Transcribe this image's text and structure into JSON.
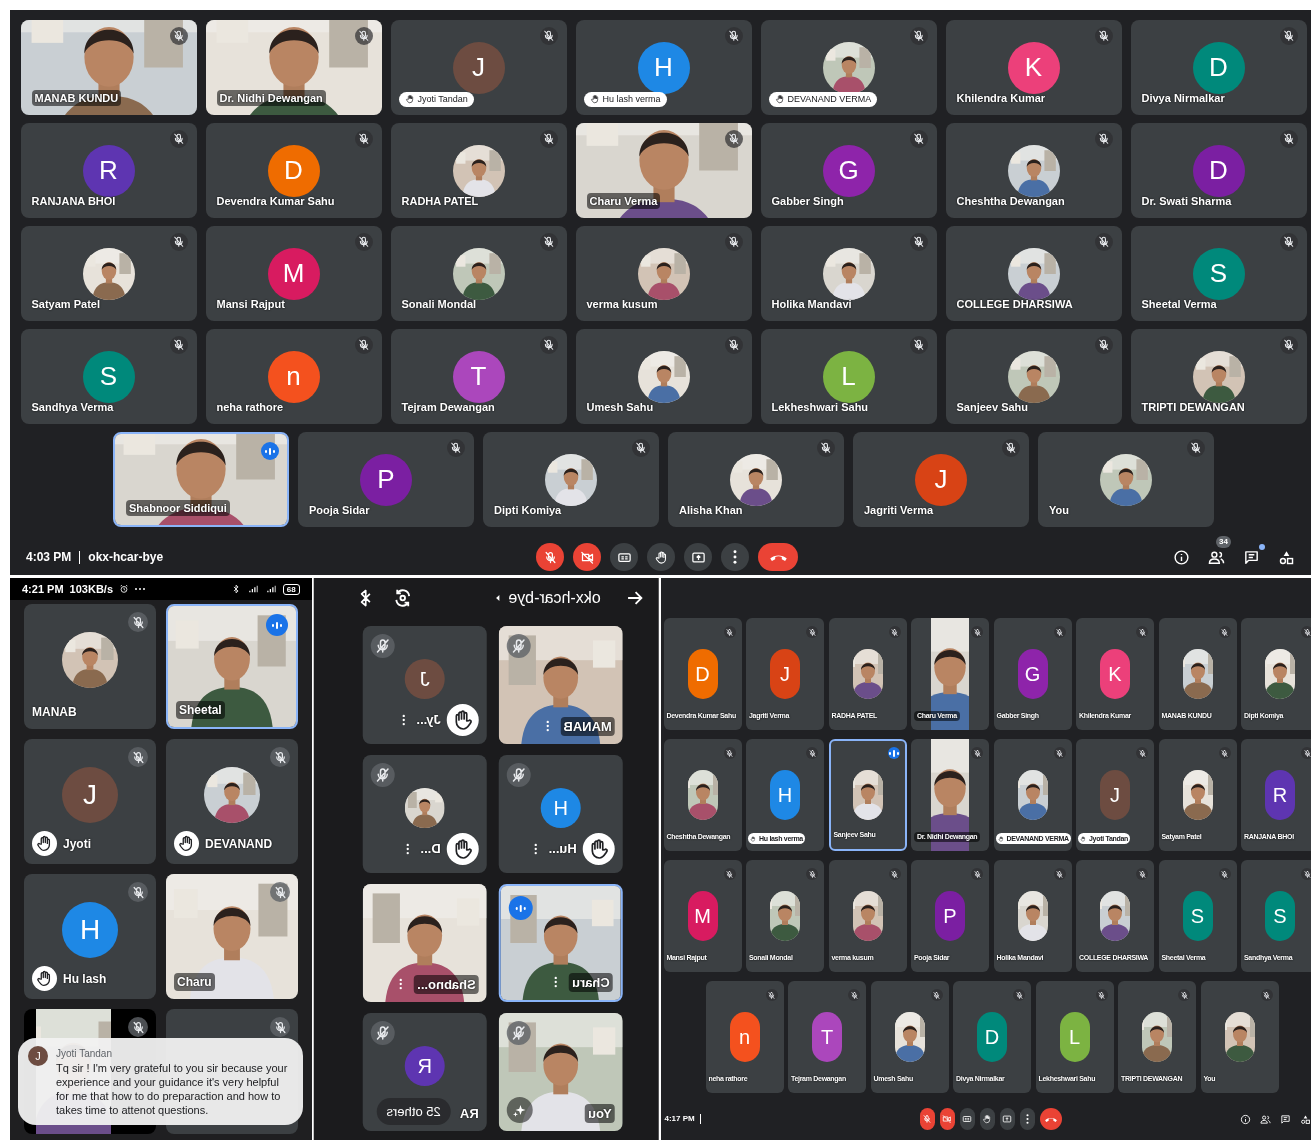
{
  "desktop_meeting": {
    "rows": [
      [
        {
          "name": "MANAB KUNDU",
          "kind": "video",
          "hand": false,
          "speaking": false,
          "muted": true
        },
        {
          "name": "Dr. Nidhi Dewangan",
          "kind": "video",
          "hand": false,
          "speaking": false,
          "muted": true
        },
        {
          "name": "Jyoti Tandan",
          "kind": "letter",
          "letter": "J",
          "color": "#6d4c41",
          "hand": true,
          "speaking": false,
          "muted": true
        },
        {
          "name": "Hu lash verma",
          "kind": "letter",
          "letter": "H",
          "color": "#1e88e5",
          "hand": true,
          "speaking": false,
          "muted": true
        },
        {
          "name": "DEVANAND VERMA",
          "hand": true,
          "speaking": false,
          "muted": true
        },
        {
          "name": "Khilendra Kumar",
          "kind": "letter",
          "letter": "K",
          "color": "#ec407a",
          "hand": false,
          "speaking": false,
          "muted": true
        },
        {
          "name": "Divya Nirmalkar",
          "kind": "letter",
          "letter": "D",
          "color": "#00897b",
          "hand": false,
          "speaking": false,
          "muted": true
        }
      ],
      [
        {
          "name": "RANJANA BHOI",
          "kind": "letter",
          "letter": "R",
          "color": "#5e35b1",
          "hand": false,
          "speaking": false,
          "muted": true
        },
        {
          "name": "Devendra Kumar Sahu",
          "kind": "letter",
          "letter": "D",
          "color": "#ef6c00",
          "hand": false,
          "speaking": false,
          "muted": true
        },
        {
          "name": "RADHA PATEL",
          "hand": false,
          "speaking": false,
          "muted": true
        },
        {
          "name": "Charu Verma",
          "kind": "video",
          "hand": false,
          "speaking": false,
          "muted": true
        },
        {
          "name": "Gabber Singh",
          "kind": "letter",
          "letter": "G",
          "color": "#8e24aa",
          "hand": false,
          "speaking": false,
          "muted": true
        },
        {
          "name": "Cheshtha Dewangan",
          "hand": false,
          "speaking": false,
          "muted": true
        },
        {
          "name": "Dr. Swati Sharma",
          "kind": "letter",
          "letter": "D",
          "color": "#7b1fa2",
          "hand": false,
          "speaking": false,
          "muted": true
        }
      ],
      [
        {
          "name": "Satyam Patel",
          "hand": false,
          "speaking": false,
          "muted": true
        },
        {
          "name": "Mansi Rajput",
          "kind": "letter",
          "letter": "M",
          "color": "#d81b60",
          "hand": false,
          "speaking": false,
          "muted": true
        },
        {
          "name": "Sonali Mondal",
          "hand": false,
          "speaking": false,
          "muted": true
        },
        {
          "name": "verma kusum",
          "hand": false,
          "speaking": false,
          "muted": true
        },
        {
          "name": "Holika Mandavi",
          "hand": false,
          "speaking": false,
          "muted": true
        },
        {
          "name": "COLLEGE DHARSIWA",
          "hand": false,
          "speaking": false,
          "muted": true
        },
        {
          "name": "Sheetal Verma",
          "kind": "letter",
          "letter": "S",
          "color": "#00897b",
          "hand": false,
          "speaking": false,
          "muted": true
        }
      ],
      [
        {
          "name": "Sandhya Verma",
          "kind": "letter",
          "letter": "S",
          "color": "#00897b",
          "hand": false,
          "speaking": false,
          "muted": true
        },
        {
          "name": "neha rathore",
          "kind": "letter",
          "letter": "n",
          "color": "#f4511e",
          "hand": false,
          "speaking": false,
          "muted": true
        },
        {
          "name": "Tejram Dewangan",
          "kind": "letter",
          "letter": "T",
          "color": "#ab47bc",
          "hand": false,
          "speaking": false,
          "muted": true
        },
        {
          "name": "Umesh Sahu",
          "hand": false,
          "speaking": false,
          "muted": true
        },
        {
          "name": "Lekheshwari Sahu",
          "kind": "letter",
          "letter": "L",
          "color": "#7cb342",
          "hand": false,
          "speaking": false,
          "muted": true
        },
        {
          "name": "Sanjeev Sahu",
          "hand": false,
          "speaking": false,
          "muted": true
        },
        {
          "name": "TRIPTI DEWANGAN",
          "hand": false,
          "speaking": false,
          "muted": true
        }
      ],
      [
        {
          "name": "Shabnoor Siddiqui",
          "kind": "video",
          "hand": false,
          "speaking": true,
          "muted": false
        },
        {
          "name": "Pooja Sidar",
          "kind": "letter",
          "letter": "P",
          "color": "#7b1fa2",
          "hand": false,
          "speaking": false,
          "muted": true
        },
        {
          "name": "Dipti Komiya",
          "hand": false,
          "speaking": false,
          "muted": true
        },
        {
          "name": "Alisha Khan",
          "hand": false,
          "speaking": false,
          "muted": true
        },
        {
          "name": "Jagriti Verma",
          "kind": "letter",
          "letter": "J",
          "color": "#d84315",
          "hand": false,
          "speaking": false,
          "muted": true
        },
        {
          "name": "You",
          "hand": false,
          "speaking": false,
          "muted": true
        }
      ]
    ],
    "bar": {
      "time": "4:03 PM",
      "meeting_code": "okx-hcar-bye",
      "controls": [
        {
          "kind": "mic",
          "off": true
        },
        {
          "kind": "camera",
          "off": true
        },
        {
          "kind": "captions",
          "off": false
        },
        {
          "kind": "hand",
          "off": false
        },
        {
          "kind": "present",
          "off": false
        },
        {
          "kind": "more",
          "off": false
        },
        {
          "kind": "end"
        }
      ],
      "side": [
        {
          "kind": "info"
        },
        {
          "kind": "people",
          "badge": "34"
        },
        {
          "kind": "chat",
          "unread": true
        },
        {
          "kind": "activities"
        }
      ]
    }
  },
  "phone_left": {
    "status": {
      "time": "4:21 PM",
      "speed": "103KB/s",
      "battery": "68"
    },
    "tiles": [
      {
        "name": "MANAB",
        "hand": false,
        "speaking": false,
        "muted": true
      },
      {
        "name": "Sheetal",
        "kind": "video",
        "hand": false,
        "speaking": true,
        "muted": false
      },
      {
        "name": "Jyoti",
        "kind": "letter",
        "letter": "J",
        "color": "#6d4c41",
        "hand": true,
        "speaking": false,
        "muted": true
      },
      {
        "name": "DEVANAND",
        "hand": true,
        "speaking": false,
        "muted": true
      },
      {
        "name": "Hu lash",
        "kind": "letter",
        "letter": "H",
        "color": "#1e88e5",
        "hand": true,
        "speaking": false,
        "muted": true
      },
      {
        "name": "Charu",
        "kind": "video",
        "hand": false,
        "speaking": false,
        "muted": true
      },
      {
        "kind": "video",
        "hand": false,
        "speaking": false,
        "muted": true
      },
      {
        "kind": "blank",
        "hand": false,
        "speaking": false,
        "muted": true
      }
    ],
    "notification": {
      "letter": "J",
      "sender": "Jyoti Tandan",
      "message": "Tq sir ! I'm very grateful to you sir because your experience and your guidance it's very helpful for me that how to do preparaction and how to takes time to attenot questions."
    }
  },
  "phone_mirrored": {
    "meeting_code": "okx-hcar-bye",
    "others": "25 others",
    "tiles": [
      {
        "name": "Jy...",
        "kind": "letter",
        "letter": "J",
        "color": "#6d4c41",
        "hand": true,
        "speaking": false,
        "muted": true
      },
      {
        "name": "MANAB",
        "kind": "video",
        "hand": false,
        "speaking": false,
        "muted": true
      },
      {
        "name": "D...",
        "hand": true,
        "speaking": false,
        "muted": true
      },
      {
        "name": "Hu...",
        "kind": "letter",
        "letter": "H",
        "color": "#1e88e5",
        "hand": true,
        "speaking": false,
        "muted": true
      },
      {
        "name": "Shabno...",
        "kind": "video",
        "hand": false,
        "speaking": false,
        "muted": false
      },
      {
        "name": "Charu",
        "kind": "video",
        "hand": false,
        "speaking": true,
        "muted": false
      },
      {
        "name": "RA",
        "kind": "letter",
        "letter": "R",
        "color": "#5e35b1",
        "hand": false,
        "speaking": false,
        "muted": true
      },
      {
        "name": "You",
        "kind": "video",
        "hand": false,
        "speaking": false,
        "muted": true,
        "effects": true
      }
    ]
  },
  "desktop_meeting_2": {
    "rows": [
      [
        {
          "name": "Devendra Kumar Sahu",
          "kind": "letter",
          "letter": "D",
          "color": "#ef6c00",
          "hand": false,
          "speaking": false,
          "muted": true
        },
        {
          "name": "Jagriti Verma",
          "kind": "letter",
          "letter": "J",
          "color": "#d84315",
          "hand": false,
          "speaking": false,
          "muted": true
        },
        {
          "name": "RADHA PATEL",
          "hand": false,
          "speaking": false,
          "muted": true
        },
        {
          "name": "Charu Verma",
          "kind": "video",
          "hand": false,
          "speaking": false,
          "muted": true
        },
        {
          "name": "Gabber Singh",
          "kind": "letter",
          "letter": "G",
          "color": "#8e24aa",
          "hand": false,
          "speaking": false,
          "muted": true
        },
        {
          "name": "Khilendra Kumar",
          "kind": "letter",
          "letter": "K",
          "color": "#ec407a",
          "hand": false,
          "speaking": false,
          "muted": true
        },
        {
          "name": "MANAB KUNDU",
          "hand": false,
          "speaking": false,
          "muted": true
        },
        {
          "name": "Dipti Komiya",
          "hand": false,
          "speaking": false,
          "muted": true
        }
      ],
      [
        {
          "name": "Cheshtha Dewangan",
          "hand": false,
          "speaking": false,
          "muted": true
        },
        {
          "name": "Hu lash verma",
          "kind": "letter",
          "letter": "H",
          "color": "#1e88e5",
          "hand": true,
          "speaking": false,
          "muted": true
        },
        {
          "name": "Sanjeev Sahu",
          "hand": false,
          "speaking": true,
          "muted": false
        },
        {
          "name": "Dr. Nidhi Dewangan",
          "kind": "video",
          "hand": false,
          "speaking": false,
          "muted": true
        },
        {
          "name": "DEVANAND VERMA",
          "hand": true,
          "speaking": false,
          "muted": true
        },
        {
          "name": "Jyoti Tandan",
          "kind": "letter",
          "letter": "J",
          "color": "#6d4c41",
          "hand": true,
          "speaking": false,
          "muted": true
        },
        {
          "name": "Satyam Patel",
          "hand": false,
          "speaking": false,
          "muted": true
        },
        {
          "name": "RANJANA BHOI",
          "kind": "letter",
          "letter": "R",
          "color": "#5e35b1",
          "hand": false,
          "speaking": false,
          "muted": true
        }
      ],
      [
        {
          "name": "Mansi Rajput",
          "kind": "letter",
          "letter": "M",
          "color": "#d81b60",
          "hand": false,
          "speaking": false,
          "muted": true
        },
        {
          "name": "Sonali Mondal",
          "hand": false,
          "speaking": false,
          "muted": true
        },
        {
          "name": "verma kusum",
          "hand": false,
          "speaking": false,
          "muted": true
        },
        {
          "name": "Pooja Sidar",
          "kind": "letter",
          "letter": "P",
          "color": "#7b1fa2",
          "hand": false,
          "speaking": false,
          "muted": true
        },
        {
          "name": "Holika Mandavi",
          "hand": false,
          "speaking": false,
          "muted": true
        },
        {
          "name": "COLLEGE DHARSIWA",
          "hand": false,
          "speaking": false,
          "muted": true
        },
        {
          "name": "Sheetal Verma",
          "kind": "letter",
          "letter": "S",
          "color": "#00897b",
          "hand": false,
          "speaking": false,
          "muted": true
        },
        {
          "name": "Sandhya Verma",
          "kind": "letter",
          "letter": "S",
          "color": "#00897b",
          "hand": false,
          "speaking": false,
          "muted": true
        }
      ],
      [
        {
          "name": "neha rathore",
          "kind": "letter",
          "letter": "n",
          "color": "#f4511e",
          "hand": false,
          "speaking": false,
          "muted": true
        },
        {
          "name": "Tejram Dewangan",
          "kind": "letter",
          "letter": "T",
          "color": "#ab47bc",
          "hand": false,
          "speaking": false,
          "muted": true
        },
        {
          "name": "Umesh Sahu",
          "hand": false,
          "speaking": false,
          "muted": true
        },
        {
          "name": "Divya Nirmalkar",
          "kind": "letter",
          "letter": "D",
          "color": "#00897b",
          "hand": false,
          "speaking": false,
          "muted": true
        },
        {
          "name": "Lekheshwari Sahu",
          "kind": "letter",
          "letter": "L",
          "color": "#7cb342",
          "hand": false,
          "speaking": false,
          "muted": true
        },
        {
          "name": "TRIPTI DEWANGAN",
          "hand": false,
          "speaking": false,
          "muted": true
        },
        {
          "name": "You",
          "hand": false,
          "speaking": false,
          "muted": true
        }
      ]
    ],
    "bar": {
      "time": "4:17 PM",
      "controls": [
        {
          "kind": "mic",
          "off": true
        },
        {
          "kind": "camera",
          "off": true
        },
        {
          "kind": "captions",
          "off": false
        },
        {
          "kind": "hand",
          "off": false
        },
        {
          "kind": "present",
          "off": false
        },
        {
          "kind": "more",
          "off": false
        },
        {
          "kind": "end"
        }
      ],
      "side": [
        {
          "kind": "info"
        },
        {
          "kind": "people"
        },
        {
          "kind": "chat",
          "unread": false
        },
        {
          "kind": "activities"
        }
      ]
    }
  }
}
